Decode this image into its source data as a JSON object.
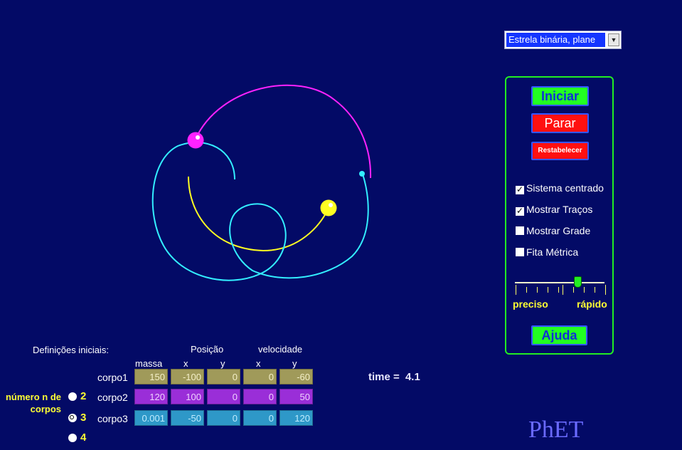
{
  "preset": {
    "selected": "Estrela binária, plane"
  },
  "panel": {
    "start_label": "Iniciar",
    "stop_label": "Parar",
    "reset_label": "Restabelecer",
    "help_label": "Ajuda",
    "checkboxes": [
      {
        "label": "Sistema centrado",
        "checked": true
      },
      {
        "label": "Mostrar Traços",
        "checked": true
      },
      {
        "label": "Mostrar Grade",
        "checked": false
      },
      {
        "label": "Fita Métrica",
        "checked": false
      }
    ],
    "slider": {
      "left_label": "preciso",
      "right_label": "rápido",
      "value_fraction": 0.69
    }
  },
  "initial": {
    "title": "Definições iniciais:",
    "mass_header": "massa",
    "position_header": "Posição",
    "velocity_header": "velocidade",
    "x_label": "x",
    "y_label": "y",
    "bodies": [
      {
        "name": "corpo1",
        "mass": "150",
        "x": "-100",
        "y": "0",
        "vx": "0",
        "vy": "-60"
      },
      {
        "name": "corpo2",
        "mass": "120",
        "x": "100",
        "y": "0",
        "vx": "0",
        "vy": "50"
      },
      {
        "name": "corpo3",
        "mass": "0.001",
        "x": "-50",
        "y": "0",
        "vx": "0",
        "vy": "120"
      }
    ]
  },
  "nbodies": {
    "label_line1": "número n de",
    "label_line2": "corpos",
    "options": [
      "2",
      "3",
      "4"
    ],
    "selected": "3"
  },
  "time": {
    "label": "time =",
    "value": "4.1"
  },
  "logo": "PhET",
  "colors": {
    "body1": "#ffff22",
    "body2": "#ff22ff",
    "body3": "#33eeff",
    "panel_border": "#22ee22"
  }
}
